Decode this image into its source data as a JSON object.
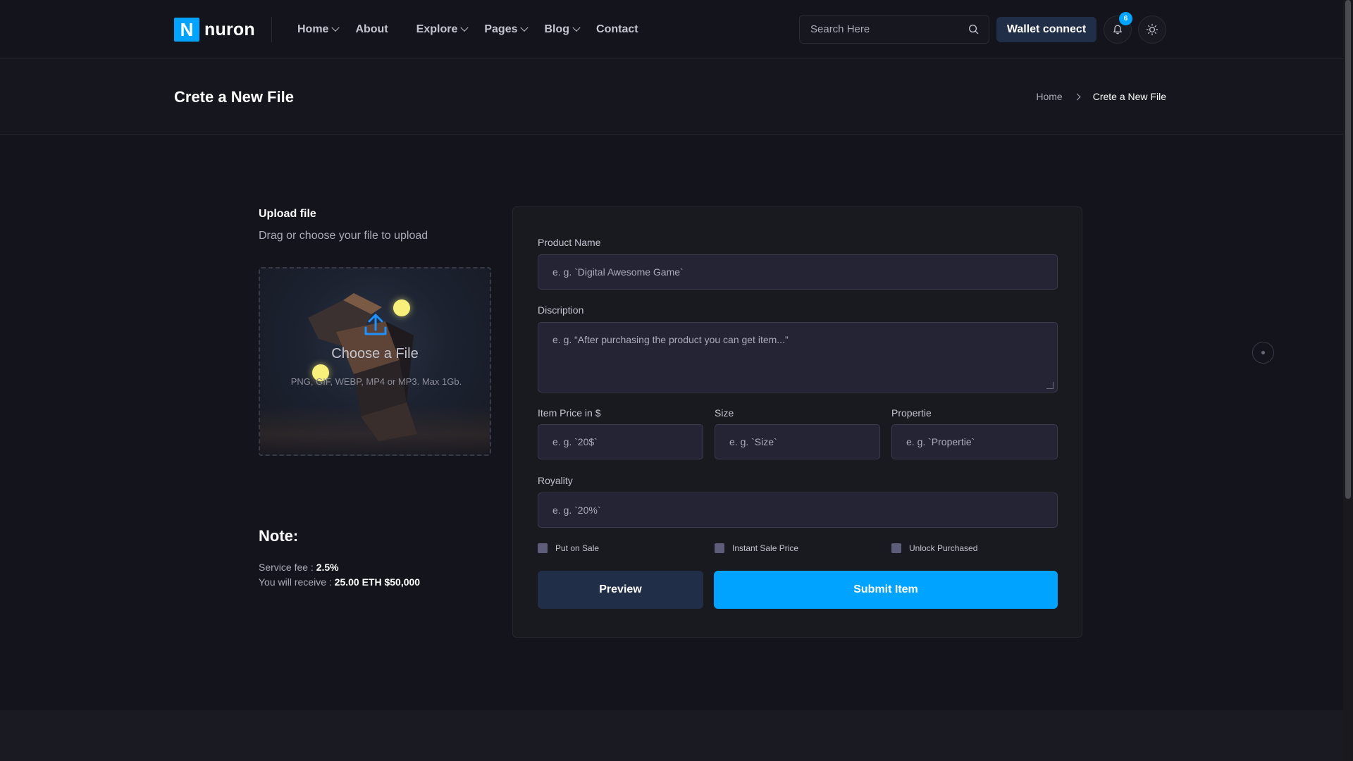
{
  "header": {
    "logo_letter": "N",
    "logo_text": "nuron",
    "nav": [
      {
        "label": "Home",
        "dropdown": true
      },
      {
        "label": "About",
        "dropdown": false
      },
      {
        "label": "Explore",
        "dropdown": true
      },
      {
        "label": "Pages",
        "dropdown": true
      },
      {
        "label": "Blog",
        "dropdown": true
      },
      {
        "label": "Contact",
        "dropdown": false
      }
    ],
    "search_placeholder": "Search Here",
    "wallet_label": "Wallet connect",
    "notification_count": "6"
  },
  "title_band": {
    "title": "Crete a New File",
    "breadcrumb_home": "Home",
    "breadcrumb_current": "Crete a New File"
  },
  "upload": {
    "title": "Upload file",
    "subtitle": "Drag or choose your file to upload",
    "choose_label": "Choose a File",
    "hint": "PNG, GIF, WEBP, MP4 or MP3. Max 1Gb."
  },
  "note": {
    "title": "Note:",
    "fee_label": "Service fee : ",
    "fee_value": "2.5%",
    "receive_label": "You will receive : ",
    "receive_value": "25.00 ETH $50,000"
  },
  "form": {
    "product_name_label": "Product Name",
    "product_name_placeholder": "e. g. `Digital Awesome Game`",
    "description_label": "Discription",
    "description_placeholder": "e. g. “After purchasing the product you can get item...”",
    "price_label": "Item Price in $",
    "price_placeholder": "e. g. `20$`",
    "size_label": "Size",
    "size_placeholder": "e. g. `Size`",
    "propertie_label": "Propertie",
    "propertie_placeholder": "e. g. `Propertie`",
    "royality_label": "Royality",
    "royality_placeholder": "e. g. `20%`",
    "checks": [
      "Put on Sale",
      "Instant Sale Price",
      "Unlock Purchased"
    ],
    "preview_label": "Preview",
    "submit_label": "Submit Item"
  },
  "colors": {
    "accent": "#00a3ff",
    "dark_button": "#212e48",
    "background": "#14141c",
    "input_bg": "#242435"
  }
}
